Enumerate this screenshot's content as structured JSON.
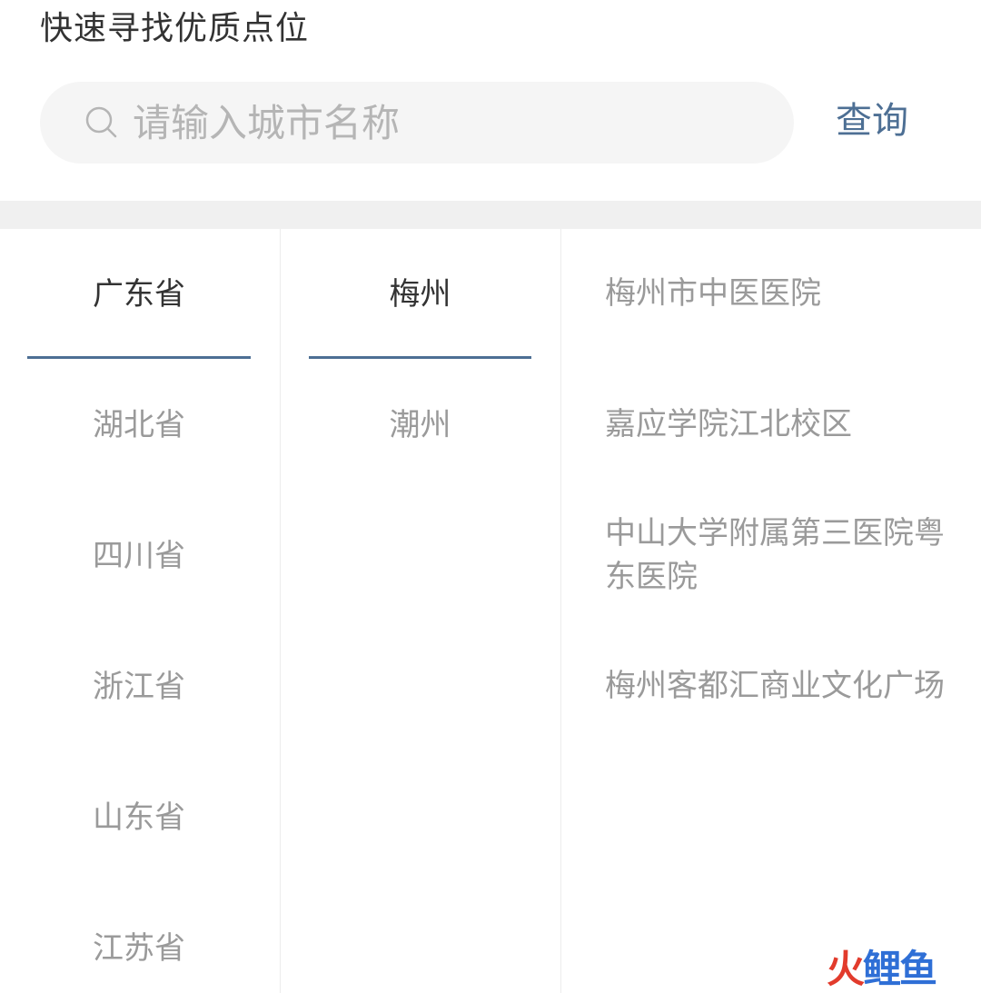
{
  "header": {
    "title": "快速寻找优质点位"
  },
  "search": {
    "placeholder": "请输入城市名称",
    "value": "",
    "button_label": "查询",
    "icon": "search-icon"
  },
  "provinces": {
    "active_index": 0,
    "items": [
      "广东省",
      "湖北省",
      "四川省",
      "浙江省",
      "山东省",
      "江苏省"
    ]
  },
  "cities": {
    "active_index": 0,
    "items": [
      "梅州",
      "潮州"
    ]
  },
  "locations": {
    "items": [
      "梅州市中医医院",
      "嘉应学院江北校区",
      "中山大学附属第三医院粤东医院",
      "梅州客都汇商业文化广场"
    ]
  },
  "watermark": {
    "text_part1": "火",
    "text_part2": "鲤鱼"
  },
  "colors": {
    "accent": "#4d6f94",
    "active_text": "#333333",
    "inactive_text": "#9a9a9a",
    "band": "#f0f0f0"
  }
}
